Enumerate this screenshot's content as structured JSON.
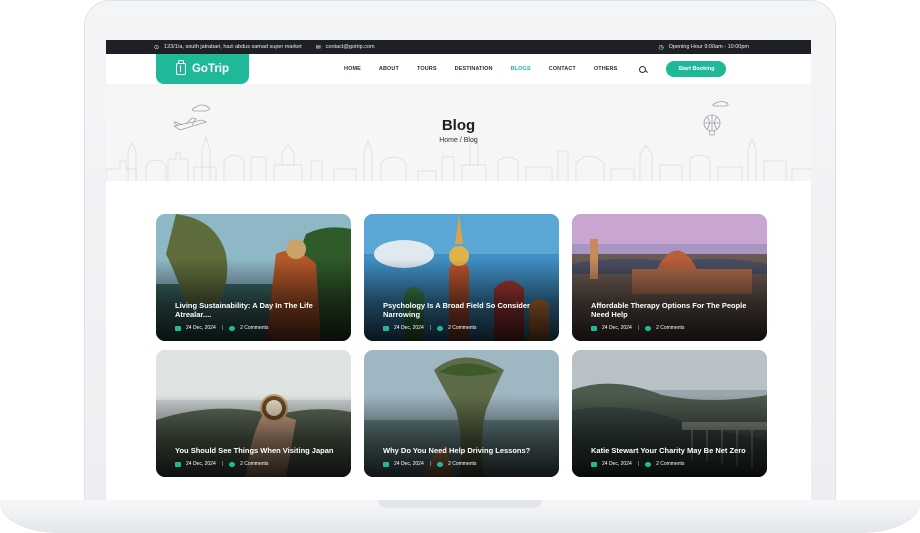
{
  "topbar": {
    "address": "123/1/a, south jatrabari, hazi abdus samad super market",
    "email": "contact@gotrip.com",
    "hours": "Opening Hour 9:00am - 10:00pm"
  },
  "brand": {
    "name": "GoTrip"
  },
  "nav": {
    "items": [
      "HOME",
      "ABOUT",
      "TOURS",
      "DESTINATION",
      "BLOGS",
      "CONTACT",
      "OTHERS"
    ],
    "active": "BLOGS",
    "cta": "Start Booking"
  },
  "hero": {
    "title": "Blog",
    "breadcrumb": "Home / Blog"
  },
  "posts": [
    {
      "title": "Living Sustainability: A Day In The Life Atrealar....",
      "date": "24 Dec, 2024",
      "comments": "2 Comments"
    },
    {
      "title": "Psychology Is A Broad Field So Consider Narrowing",
      "date": "24 Dec, 2024",
      "comments": "2 Comments"
    },
    {
      "title": "Affordable Therapy Options For The People Need Help",
      "date": "24 Dec, 2024",
      "comments": "2 Comments"
    },
    {
      "title": "You Should See Things When Visiting Japan",
      "date": "24 Dec, 2024",
      "comments": "2 Comments"
    },
    {
      "title": "Why Do You Need Help Driving Lessons?",
      "date": "24 Dec, 2024",
      "comments": "2 Comments"
    },
    {
      "title": "Katie Stewart Your Charity May Be Net Zero",
      "date": "24 Dec, 2024",
      "comments": "2 Comments"
    }
  ],
  "colors": {
    "accent": "#1fb99a",
    "topbar": "#1d2024"
  }
}
